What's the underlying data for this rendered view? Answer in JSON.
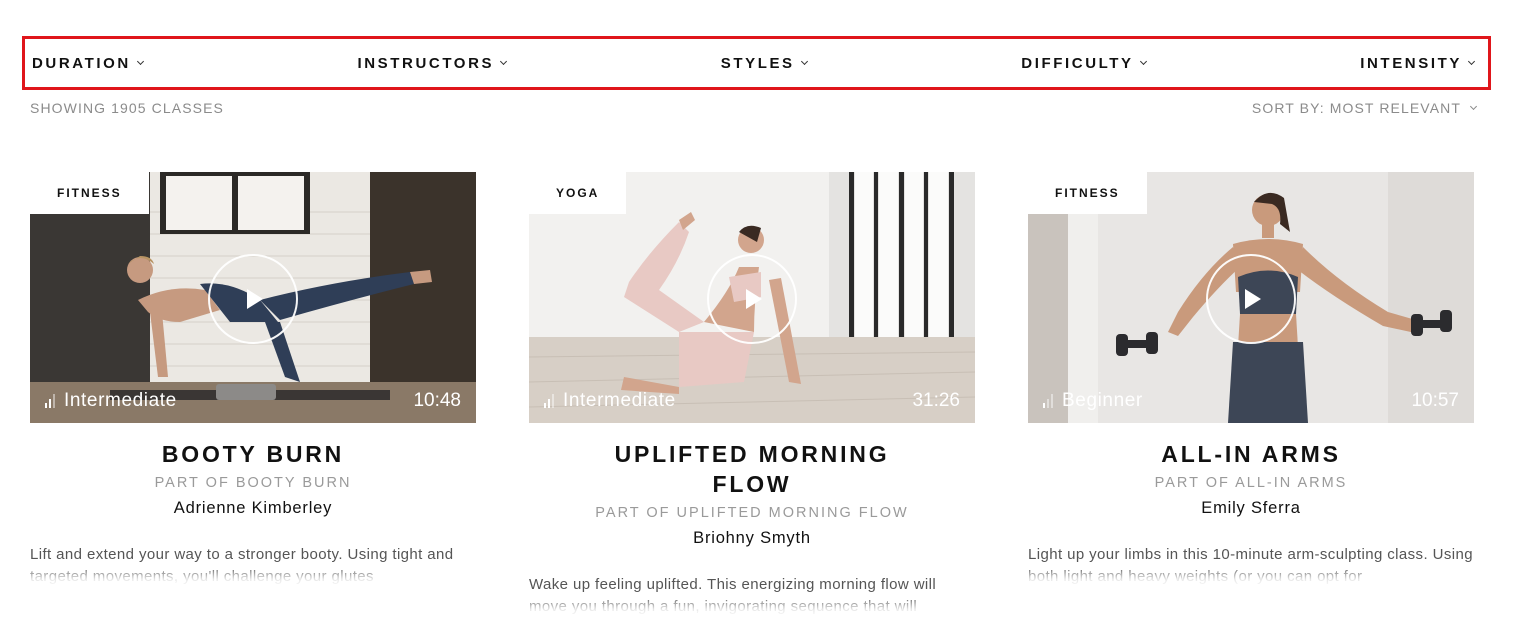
{
  "filters": {
    "duration": "DURATION",
    "instructors": "INSTRUCTORS",
    "styles": "STYLES",
    "difficulty": "DIFFICULTY",
    "intensity": "INTENSITY"
  },
  "results": {
    "count_label": "SHOWING 1905 CLASSES",
    "sort_label": "SORT BY: MOST RELEVANT"
  },
  "colors": {
    "highlight_border": "#e0161b",
    "muted_text": "#8b8b8b"
  },
  "classes": [
    {
      "category": "FITNESS",
      "level": "Intermediate",
      "level_bars_filled": 2,
      "duration": "10:48",
      "title": "BOOTY BURN",
      "series": "PART OF BOOTY BURN",
      "instructor": "Adrienne Kimberley",
      "description": "Lift and extend your way to a stronger booty. Using tight and targeted movements, you'll challenge your glutes"
    },
    {
      "category": "YOGA",
      "level": "Intermediate",
      "level_bars_filled": 2,
      "duration": "31:26",
      "title": "UPLIFTED MORNING FLOW",
      "series": "PART OF UPLIFTED MORNING FLOW",
      "instructor": "Briohny Smyth",
      "description": "Wake up feeling uplifted. This energizing morning flow will move you through a fun, invigorating sequence that will"
    },
    {
      "category": "FITNESS",
      "level": "Beginner",
      "level_bars_filled": 1,
      "duration": "10:57",
      "title": "ALL-IN ARMS",
      "series": "PART OF ALL-IN ARMS",
      "instructor": "Emily Sferra",
      "description": "Light up your limbs in this 10-minute arm-sculpting class. Using both light and heavy weights (or you can opt for"
    }
  ]
}
